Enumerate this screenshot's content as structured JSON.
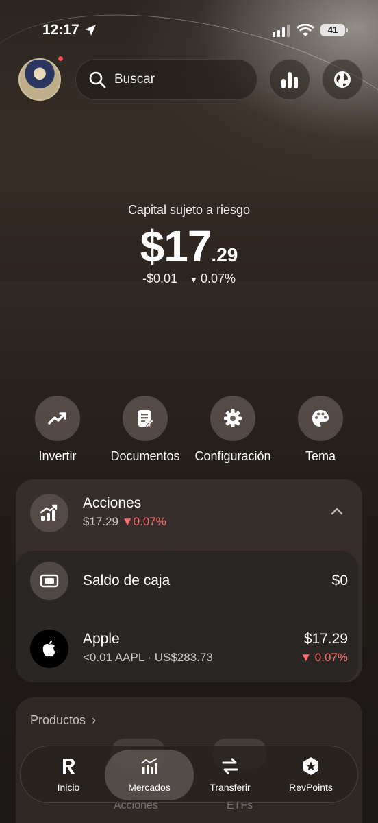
{
  "status_bar": {
    "time": "12:17",
    "battery": "41"
  },
  "header": {
    "search_placeholder": "Buscar"
  },
  "balance": {
    "caption": "Capital sujeto a riesgo",
    "whole": "$17",
    "cents": ".29",
    "change_abs": "-$0.01",
    "change_pct": "0.07%"
  },
  "actions": [
    {
      "label": "Invertir",
      "icon": "trending-up-icon"
    },
    {
      "label": "Documentos",
      "icon": "document-icon"
    },
    {
      "label": "Configuración",
      "icon": "gear-icon"
    },
    {
      "label": "Tema",
      "icon": "palette-icon"
    }
  ],
  "holdings": {
    "title": "Acciones",
    "value": "$17.29",
    "change": "0.07%",
    "cash": {
      "title": "Saldo de caja",
      "value": "$0"
    },
    "apple": {
      "title": "Apple",
      "sub": "<0.01 AAPL · US$283.73",
      "value": "$17.29",
      "change": "0.07%"
    }
  },
  "products": {
    "title": "Productos",
    "ghost_labels": [
      "Acciones",
      "ETFs"
    ]
  },
  "tabs": [
    {
      "label": "Inicio",
      "icon": "revolut-r-icon"
    },
    {
      "label": "Mercados",
      "icon": "chart-icon"
    },
    {
      "label": "Transferir",
      "icon": "transfer-icon"
    },
    {
      "label": "RevPoints",
      "icon": "hexagon-star-icon"
    }
  ],
  "colors": {
    "negative": "#ff6b6b",
    "background": "#1c1815"
  }
}
